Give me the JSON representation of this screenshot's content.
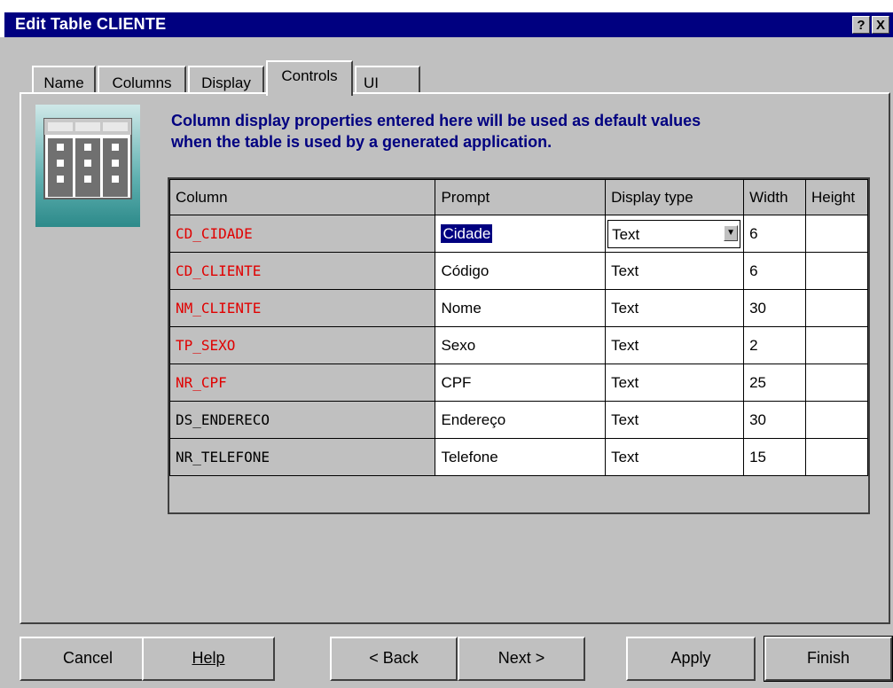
{
  "window": {
    "title": "Edit Table CLIENTE",
    "help_label": "?",
    "close_label": "X"
  },
  "tabs": [
    {
      "label": "Name"
    },
    {
      "label": "Columns"
    },
    {
      "label": "Display"
    },
    {
      "label": "Controls"
    },
    {
      "label": "UI"
    }
  ],
  "heading": {
    "line1": "Column display properties entered here will be used as default values",
    "line2": "when the table is used by a generated application."
  },
  "table": {
    "headers": [
      "Column",
      "Prompt",
      "Display type",
      "Width",
      "Height"
    ],
    "rows": [
      {
        "column": "CD_CIDADE",
        "prompt": "Cidade",
        "display": "Text",
        "width": "6",
        "height": ""
      },
      {
        "column": "CD_CLIENTE",
        "prompt": "Código",
        "display": "Text",
        "width": "6",
        "height": ""
      },
      {
        "column": "NM_CLIENTE",
        "prompt": "Nome",
        "display": "Text",
        "width": "30",
        "height": ""
      },
      {
        "column": "TP_SEXO",
        "prompt": "Sexo",
        "display": "Text",
        "width": "2",
        "height": ""
      },
      {
        "column": "NR_CPF",
        "prompt": "CPF",
        "display": "Text",
        "width": "25",
        "height": ""
      },
      {
        "column": "DS_ENDERECO",
        "prompt": "Endereço",
        "display": "Text",
        "width": "30",
        "height": ""
      },
      {
        "column": "NR_TELEFONE",
        "prompt": "Telefone",
        "display": "Text",
        "width": "15",
        "height": ""
      }
    ]
  },
  "buttons": {
    "cancel": "Cancel",
    "help": "Help",
    "back": "< Back",
    "next": "Next >",
    "apply": "Apply",
    "finish": "Finish"
  },
  "colors": {
    "title_bar": "#000080",
    "heading": "#000080",
    "required_column": "#e00000",
    "dialog": "#c0c0c0"
  }
}
